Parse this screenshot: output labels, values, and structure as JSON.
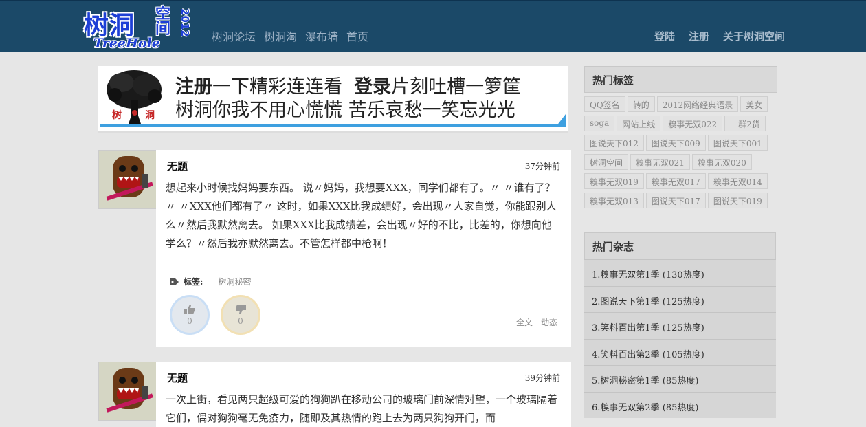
{
  "header": {
    "logo_big": "树洞",
    "logo_kong": "空间",
    "logo_year": "2012",
    "logo_en": "TreeHole",
    "nav": [
      "树洞论坛",
      "树洞淘",
      "瀑布墙",
      "首页"
    ],
    "right_nav": [
      "登陆",
      "注册",
      "关于树洞空间"
    ]
  },
  "banner": {
    "line1_bold": "注册",
    "line1_rest": "一下精彩连连看",
    "line1_bold2": "登录",
    "line1_rest2": "片刻吐槽一箩筐",
    "line2": "树洞你我不用心慌慌  苦乐哀愁一笑忘光光",
    "tree_label_left": "树",
    "tree_label_right": "洞"
  },
  "posts": [
    {
      "title": "无题",
      "time": "37分钟前",
      "body": "想起来小时候找妈妈要东西。 说〃妈妈，我想要XXX，同学们都有了。〃 〃谁有了？〃 〃XXX他们都有了〃 这时，如果XXX比我成绩好，会出现〃人家自觉，你能跟别人么〃然后我默然离去。 如果XXX比我成绩差，会出现〃好的不比，比差的，你想向他学么？〃然后我亦默然离去。不管怎样都中枪啊！",
      "tag_label": "标签:",
      "tag_value": "树洞秘密",
      "up_count": "0",
      "down_count": "0",
      "action_full": "全文",
      "action_feed": "动态"
    },
    {
      "title": "无题",
      "time": "39分钟前",
      "body": "一次上街，看见两只超级可爱的狗狗趴在移动公司的玻璃门前深情对望，一个玻璃隔着它们，偶对狗狗毫无免疫力，随即及其热情的跑上去为两只狗狗开门，而"
    }
  ],
  "sidebar": {
    "hot_tags_title": "热门标签",
    "hot_tags": [
      "QQ签名",
      "转的",
      "2012网络经典语录",
      "美女",
      "soga",
      "网站上线",
      "糗事无双022",
      "一群2货",
      "图说天下012",
      "图说天下009",
      "图说天下001",
      "树洞空间",
      "糗事无双021",
      "糗事无双020",
      "糗事无双019",
      "糗事无双017",
      "糗事无双014",
      "糗事无双013",
      "图说天下017",
      "图说天下019"
    ],
    "hot_mags_title": "热门杂志",
    "hot_mags": [
      "1.糗事无双第1季 (130热度)",
      "2.图说天下第1季 (125热度)",
      "3.笑料百出第1季 (125热度)",
      "4.笑料百出第2季 (105热度)",
      "5.树洞秘密第1季 (85热度)",
      "6.糗事无双第2季 (85热度)"
    ]
  },
  "colors": {
    "header_bg": "#1b4968",
    "logo_blue": "#1d3fd6",
    "banner_stripe": "#3ea0e0"
  }
}
